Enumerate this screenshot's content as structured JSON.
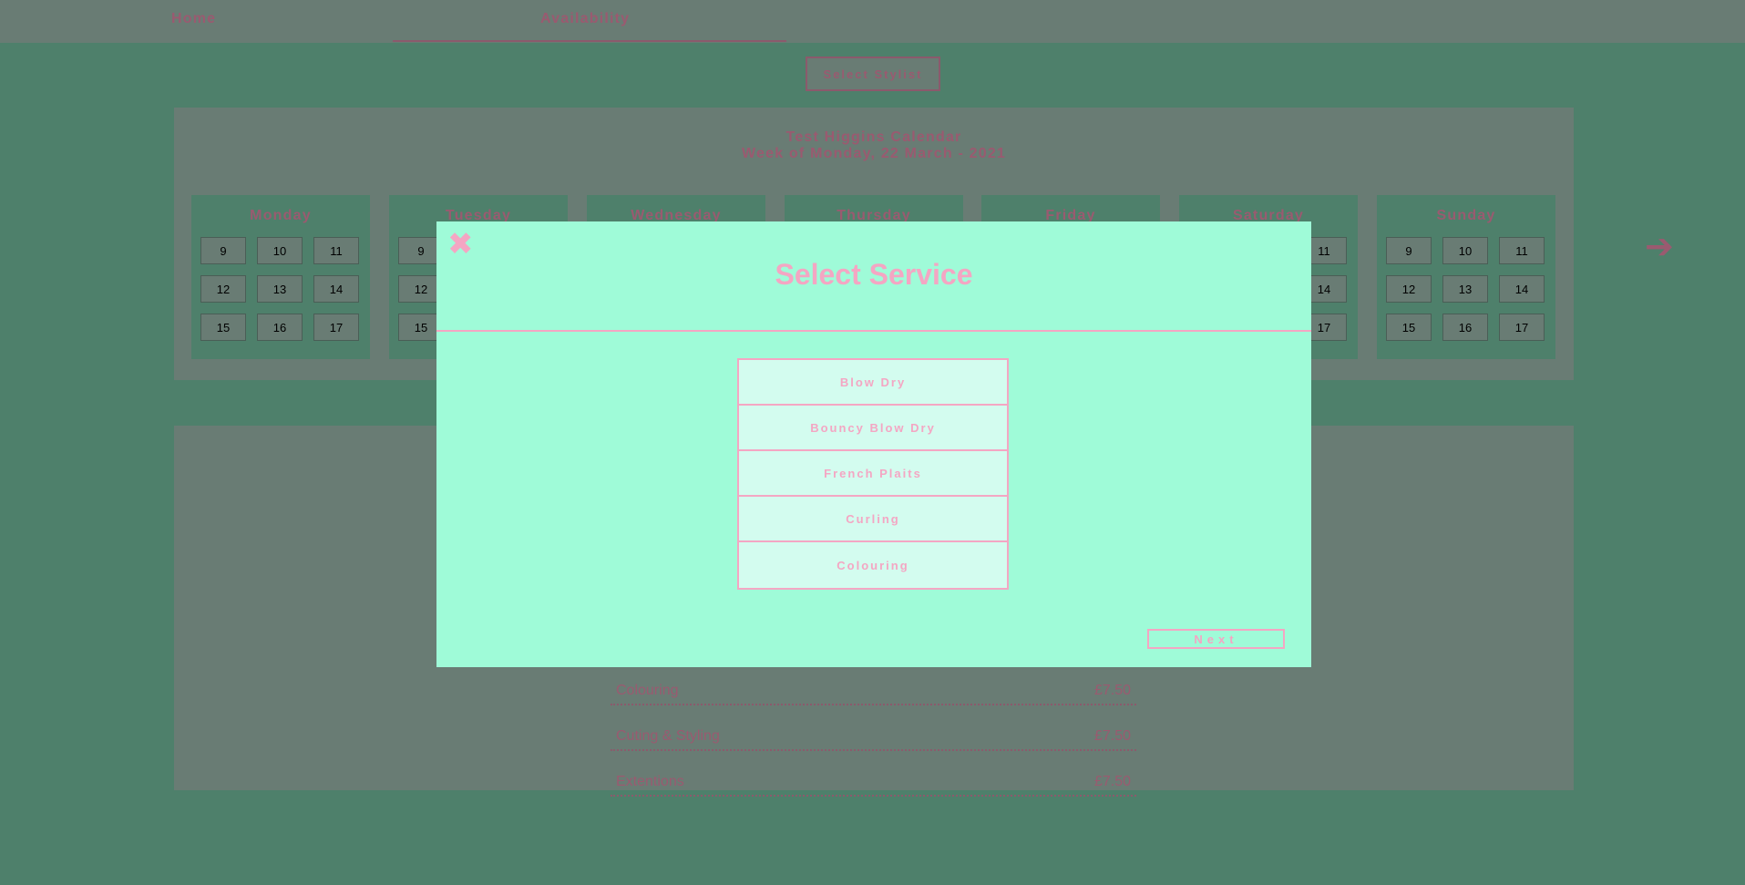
{
  "nav": {
    "home": "Home",
    "availability": "Availability"
  },
  "select_stylist": "Select Stylist",
  "calendar": {
    "title": "Test Higgins Calendar",
    "week": "Week of Monday, 22 March - 2021",
    "days": [
      "Monday",
      "Tuesday",
      "Wednesday",
      "Thursday",
      "Friday",
      "Saturday",
      "Sunday"
    ],
    "slots": [
      "9",
      "10",
      "11",
      "12",
      "13",
      "14",
      "15",
      "16",
      "17"
    ],
    "next_icon": "arrow-right-icon"
  },
  "prices": [
    {
      "service": "Colouring",
      "price": "£7.50"
    },
    {
      "service": "Cuting & Styling",
      "price": "£7.50"
    },
    {
      "service": "Extentions",
      "price": "£7.50"
    }
  ],
  "modal": {
    "close_icon": "close-icon",
    "close_glyph": "✖",
    "title": "Select Service",
    "services": [
      "Blow Dry",
      "Bouncy Blow Dry",
      "French Plaits",
      "Curling",
      "Colouring"
    ],
    "next": "Next"
  },
  "colors": {
    "page_bg": "#4e806b",
    "panel": "#697c74",
    "modal_bg": "#9ffbd8",
    "accent_pink": "#f4a6c3",
    "text_mauve": "#9a5a70"
  }
}
